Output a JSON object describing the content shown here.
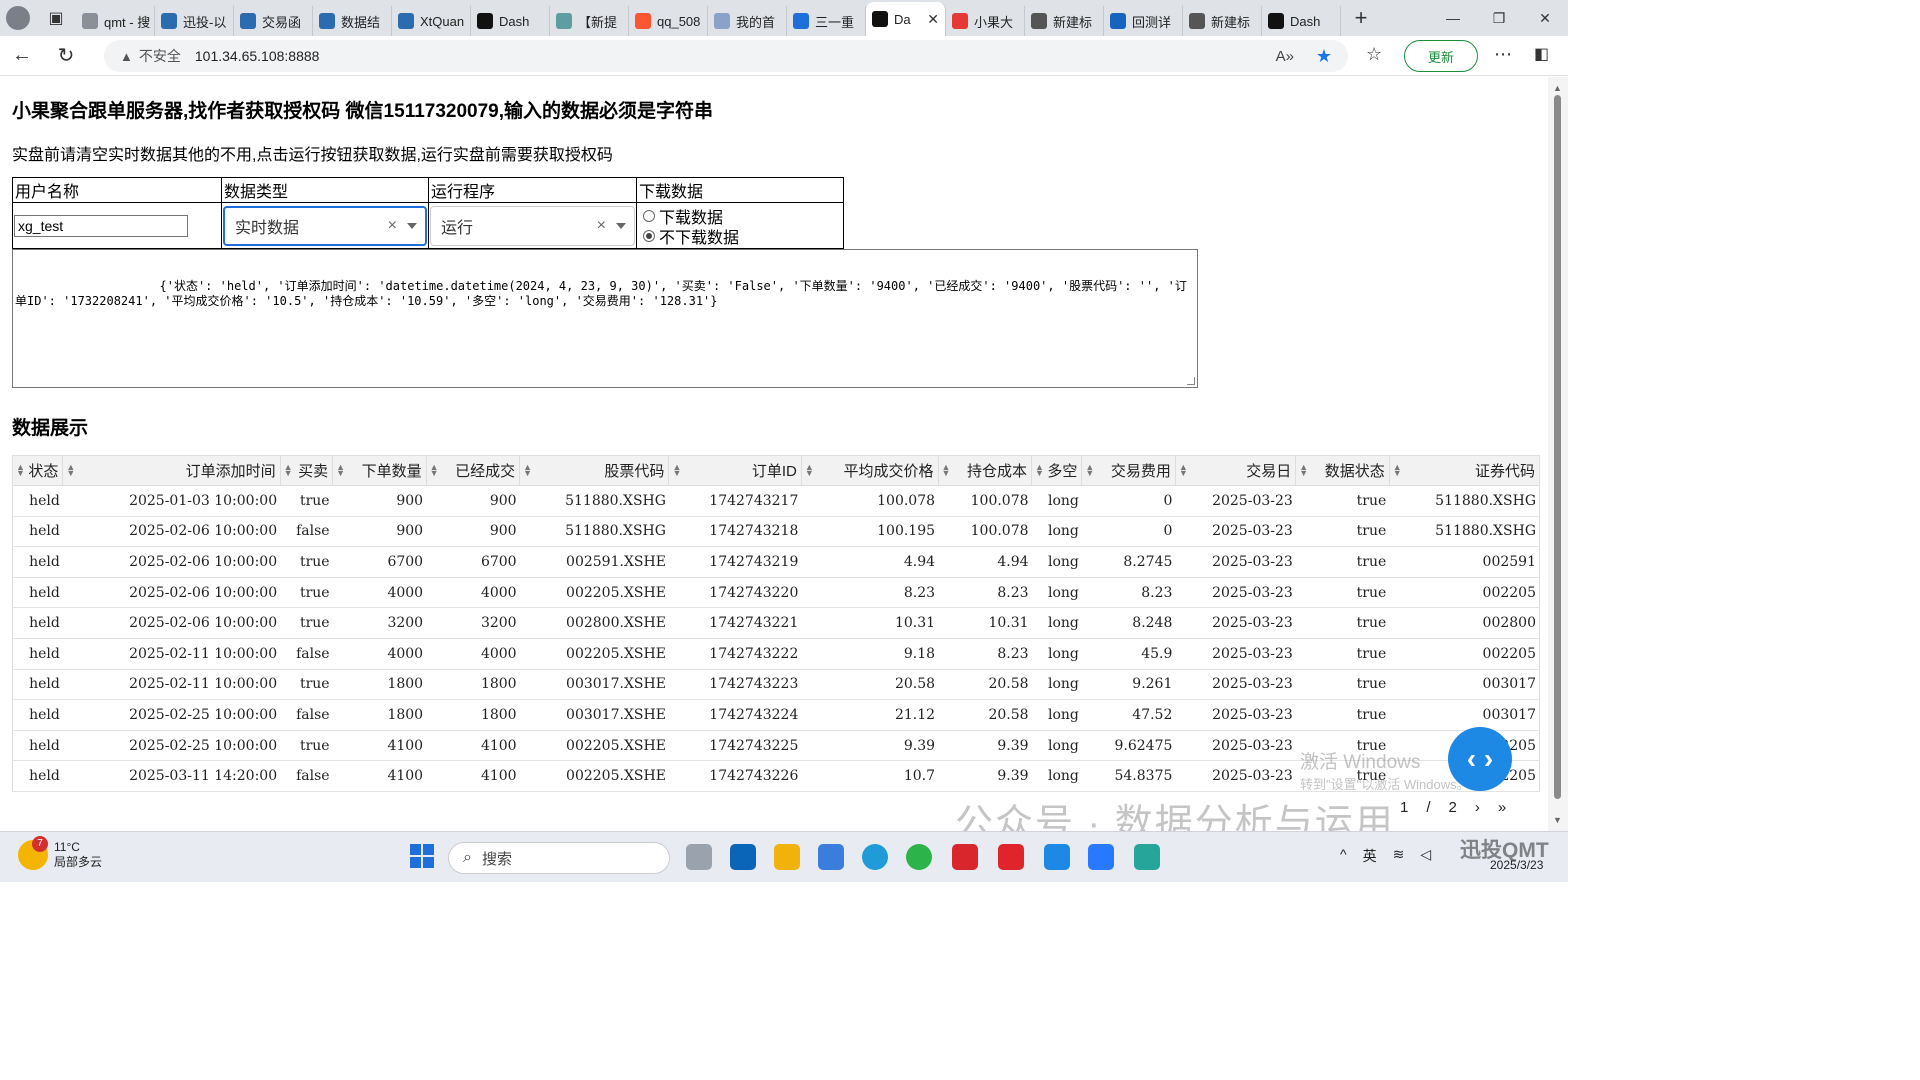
{
  "browser": {
    "tabs": [
      {
        "label": "qmt - 搜",
        "icon": "search-icon",
        "color": "#8a8f98"
      },
      {
        "label": "迅投-以",
        "icon": "xuntou-icon",
        "color": "#2b6cb0"
      },
      {
        "label": "交易函",
        "icon": "xuntou-icon",
        "color": "#2b6cb0"
      },
      {
        "label": "数据结",
        "icon": "xuntou-icon",
        "color": "#2b6cb0"
      },
      {
        "label": "XtQuan",
        "icon": "xuntou-icon",
        "color": "#2b6cb0"
      },
      {
        "label": "Dash",
        "icon": "dash-icon",
        "color": "#111111"
      },
      {
        "label": "【新提",
        "icon": "gt-icon",
        "color": "#5f9ea0"
      },
      {
        "label": "qq_508",
        "icon": "csdn-icon",
        "color": "#fc5531"
      },
      {
        "label": "我的首",
        "icon": "home-icon",
        "color": "#8aa2c8"
      },
      {
        "label": "三一重",
        "icon": "globe-icon",
        "color": "#1e6fd9"
      },
      {
        "label": "Da",
        "icon": "dash-icon",
        "color": "#111111",
        "active": true
      },
      {
        "label": "小果大",
        "icon": "xiaoguo-icon",
        "color": "#e53935"
      },
      {
        "label": "新建标",
        "icon": "page-icon",
        "color": "#555555"
      },
      {
        "label": "回测详",
        "icon": "chart-icon",
        "color": "#1565c0"
      },
      {
        "label": "新建标",
        "icon": "page-icon",
        "color": "#555555"
      },
      {
        "label": "Dash",
        "icon": "dash-icon",
        "color": "#111111"
      }
    ],
    "close_glyph": "✕",
    "new_tab": "+",
    "not_secure": "不安全",
    "url": "101.34.65.108:8888",
    "update_label": "更新"
  },
  "page": {
    "title": "小果聚合跟单服务器,找作者获取授权码 微信15117320079,输入的数据必须是字符串",
    "subtitle": "实盘前请清空实时数据其他的不用,点击运行按钮获取数据,运行实盘前需要获取授权码",
    "controls": {
      "headers": [
        "用户名称",
        "数据类型",
        "运行程序",
        "下载数据"
      ],
      "username_value": "xg_test",
      "data_type_value": "实时数据",
      "program_value": "运行",
      "radio_download": "下载数据",
      "radio_no_download": "不下载数据",
      "radio_selected": "不下载数据"
    },
    "output_text": "                {'状态': 'held', '订单添加时间': 'datetime.datetime(2024, 4, 23, 9, 30)', '买卖': 'False', '下单数量': '9400', '已经成交': '9400', '股票代码': '', '订单ID': '1732208241', '平均成交价格': '10.5', '持仓成本': '10.59', '多空': 'long', '交易费用': '128.31'}",
    "section_title": "数据展示",
    "table": {
      "columns": [
        "状态",
        "订单添加时间",
        "买卖",
        "下单数量",
        "已经成交",
        "股票代码",
        "订单ID",
        "平均成交价格",
        "持仓成本",
        "多空",
        "交易费用",
        "交易日",
        "数据状态",
        "证券代码"
      ],
      "rows": [
        [
          "held",
          "2025-01-03 10:00:00",
          "true",
          "900",
          "900",
          "511880.XSHG",
          "1742743217",
          "100.078",
          "100.078",
          "long",
          "0",
          "2025-03-23",
          "true",
          "511880.XSHG"
        ],
        [
          "held",
          "2025-02-06 10:00:00",
          "false",
          "900",
          "900",
          "511880.XSHG",
          "1742743218",
          "100.195",
          "100.078",
          "long",
          "0",
          "2025-03-23",
          "true",
          "511880.XSHG"
        ],
        [
          "held",
          "2025-02-06 10:00:00",
          "true",
          "6700",
          "6700",
          "002591.XSHE",
          "1742743219",
          "4.94",
          "4.94",
          "long",
          "8.2745",
          "2025-03-23",
          "true",
          "002591"
        ],
        [
          "held",
          "2025-02-06 10:00:00",
          "true",
          "4000",
          "4000",
          "002205.XSHE",
          "1742743220",
          "8.23",
          "8.23",
          "long",
          "8.23",
          "2025-03-23",
          "true",
          "002205"
        ],
        [
          "held",
          "2025-02-06 10:00:00",
          "true",
          "3200",
          "3200",
          "002800.XSHE",
          "1742743221",
          "10.31",
          "10.31",
          "long",
          "8.248",
          "2025-03-23",
          "true",
          "002800"
        ],
        [
          "held",
          "2025-02-11 10:00:00",
          "false",
          "4000",
          "4000",
          "002205.XSHE",
          "1742743222",
          "9.18",
          "8.23",
          "long",
          "45.9",
          "2025-03-23",
          "true",
          "002205"
        ],
        [
          "held",
          "2025-02-11 10:00:00",
          "true",
          "1800",
          "1800",
          "003017.XSHE",
          "1742743223",
          "20.58",
          "20.58",
          "long",
          "9.261",
          "2025-03-23",
          "true",
          "003017"
        ],
        [
          "held",
          "2025-02-25 10:00:00",
          "false",
          "1800",
          "1800",
          "003017.XSHE",
          "1742743224",
          "21.12",
          "20.58",
          "long",
          "47.52",
          "2025-03-23",
          "true",
          "003017"
        ],
        [
          "held",
          "2025-02-25 10:00:00",
          "true",
          "4100",
          "4100",
          "002205.XSHE",
          "1742743225",
          "9.39",
          "9.39",
          "long",
          "9.62475",
          "2025-03-23",
          "true",
          "002205"
        ],
        [
          "held",
          "2025-03-11 14:20:00",
          "false",
          "4100",
          "4100",
          "002205.XSHE",
          "1742743226",
          "10.7",
          "9.39",
          "long",
          "54.8375",
          "2025-03-23",
          "true",
          "002205"
        ]
      ]
    },
    "pager": {
      "first": "1",
      "separator": "/",
      "total": "2",
      "next": "›",
      "last": "»"
    },
    "overlay": {
      "activate_title": "激活 Windows",
      "activate_sub": "转到\"设置\"以激活 Windows。",
      "wechat_mark": "公众号 · 数据分析与运用",
      "fab_glyph": "‹ ›"
    }
  },
  "taskbar": {
    "weather_temp": "11°C",
    "weather_desc": "局部多云",
    "weather_badge": "7",
    "search_placeholder": "搜索",
    "ime": "英",
    "date": "2025/3/23",
    "brand": "迅投QMT"
  }
}
